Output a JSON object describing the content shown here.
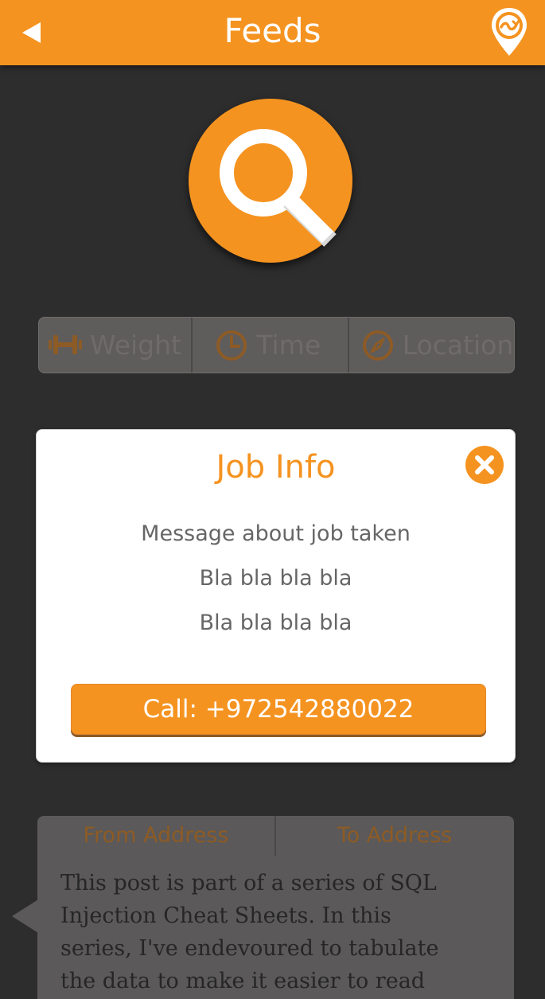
{
  "header": {
    "title": "Feeds",
    "back_icon": "back-triangle-icon",
    "location_icon": "location-pin-icon"
  },
  "search": {
    "icon": "magnifier-icon"
  },
  "filters": [
    {
      "label": "Weight",
      "icon": "dumbbell-icon"
    },
    {
      "label": "Time",
      "icon": "clock-icon"
    },
    {
      "label": "Location",
      "icon": "compass-icon"
    }
  ],
  "modal": {
    "title": "Job Info",
    "lines": [
      "Message about job taken",
      "Bla bla bla bla",
      "Bla bla bla bla"
    ],
    "call_label": "Call: +972542880022",
    "close_icon": "close-x-icon"
  },
  "address": {
    "tabs": [
      "From Address",
      "To Address"
    ]
  },
  "post": {
    "text": "This post is part of a series of SQL Injection Cheat Sheets.  In this series, I've endevoured to tabulate the data to make it easier to read"
  },
  "colors": {
    "accent": "#f59320",
    "background": "#2d2d2d",
    "panel": "#5b5959",
    "muted_text": "#666666"
  }
}
